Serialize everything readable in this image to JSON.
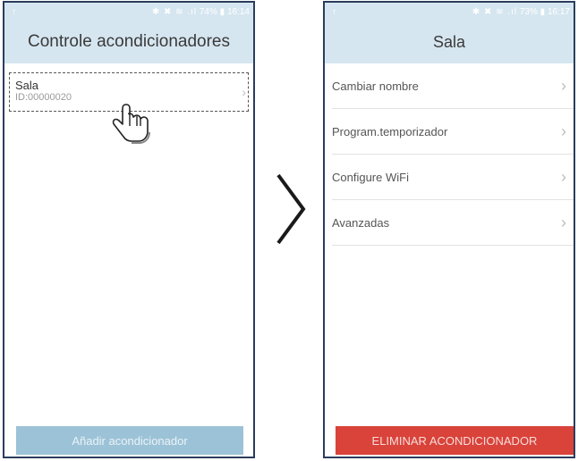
{
  "left_screen": {
    "status": {
      "left_icon": "↑",
      "icons": "✱ ✖ ≋ .ıl",
      "battery": "74%",
      "time": "16:14"
    },
    "title": "Controle acondicionadores",
    "device": {
      "name": "Sala",
      "id": "ID:00000020"
    },
    "add_button": "Añadir acondicionador"
  },
  "right_screen": {
    "status": {
      "left_icon": "↑",
      "icons": "✱ ✖ ≋ .ıl",
      "battery": "73%",
      "time": "16:17"
    },
    "title": "Sala",
    "menu": [
      {
        "label": "Cambiar nombre"
      },
      {
        "label": "Program.temporizador"
      },
      {
        "label": "Configure WiFi"
      },
      {
        "label": "Avanzadas"
      }
    ],
    "delete_button": "ELIMINAR ACONDICIONADOR"
  },
  "colors": {
    "header_bg": "#d6e6f0",
    "add_button_bg": "#9cc2d7",
    "delete_button_bg": "#d9433a",
    "frame_border": "#2a3d5c"
  },
  "icons": {
    "pointer": "hand-pointer-icon",
    "transition": "chevron-right-icon",
    "row_arrow": "chevron-right-icon"
  }
}
